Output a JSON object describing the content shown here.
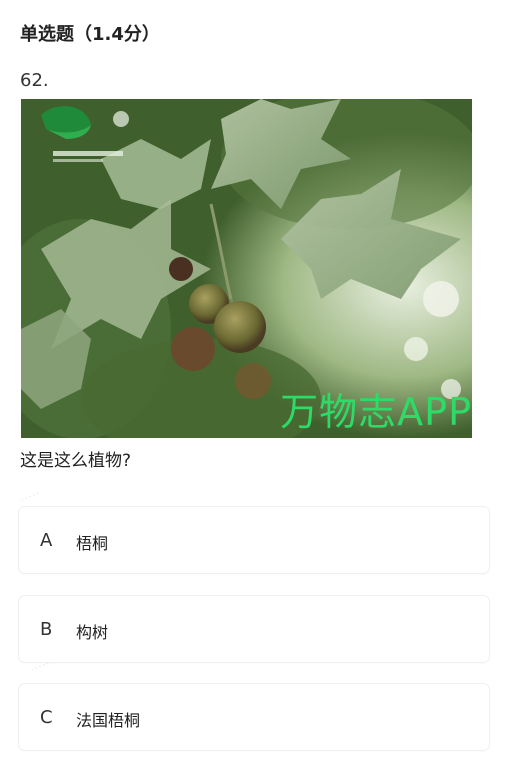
{
  "question": {
    "type_label": "单选题（1.4分）",
    "number": "62.",
    "text": "这是这么植物?",
    "image_watermark": "万物志APP"
  },
  "options": [
    {
      "letter": "A",
      "label": "梧桐"
    },
    {
      "letter": "B",
      "label": "构树"
    },
    {
      "letter": "C",
      "label": "法国梧桐"
    }
  ]
}
